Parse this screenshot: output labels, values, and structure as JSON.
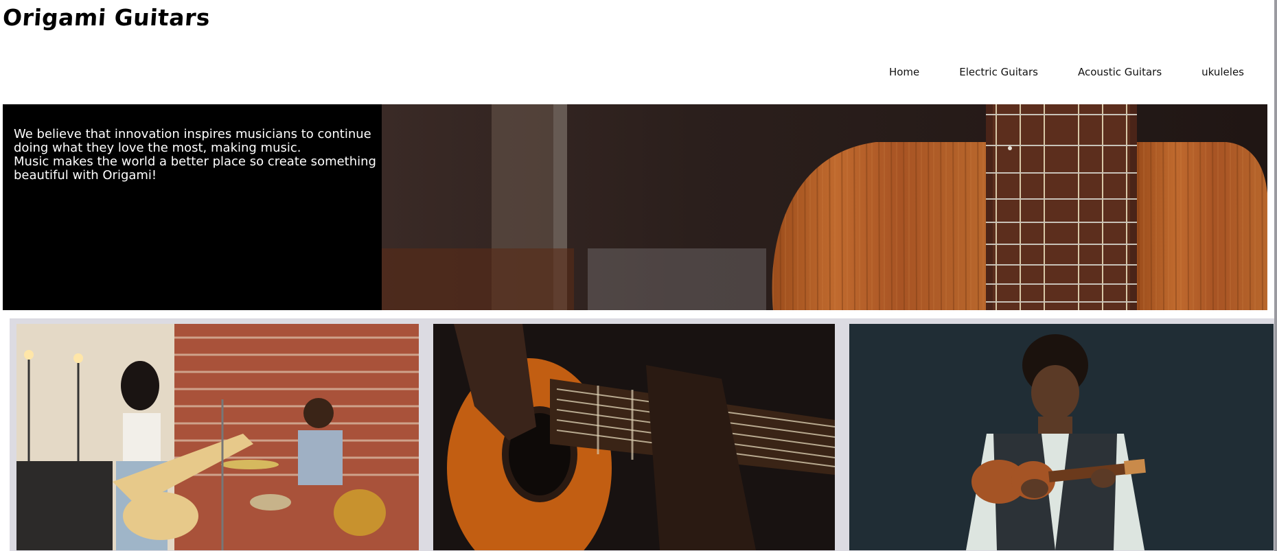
{
  "site": {
    "logo": "Origami Guitars"
  },
  "nav": {
    "items": [
      {
        "label": "Home"
      },
      {
        "label": "Electric Guitars"
      },
      {
        "label": "Acoustic Guitars"
      },
      {
        "label": "ukuleles"
      }
    ]
  },
  "hero": {
    "lines": [
      "We believe that innovation inspires musicians to continue doing what they love the most, making music.",
      "Music makes the world a better place so create something beautiful with Origami!"
    ],
    "image": "acoustic-guitar-closeup-photo"
  },
  "gallery": {
    "images": [
      "band-singer-electric-guitar-drummer-photo",
      "acoustic-guitar-strumming-photo",
      "man-playing-ukulele-photo"
    ]
  },
  "colors": {
    "hero_background": "#000000",
    "gallery_background": "#dcdbe2",
    "guitar_wood": "#b0622a"
  }
}
